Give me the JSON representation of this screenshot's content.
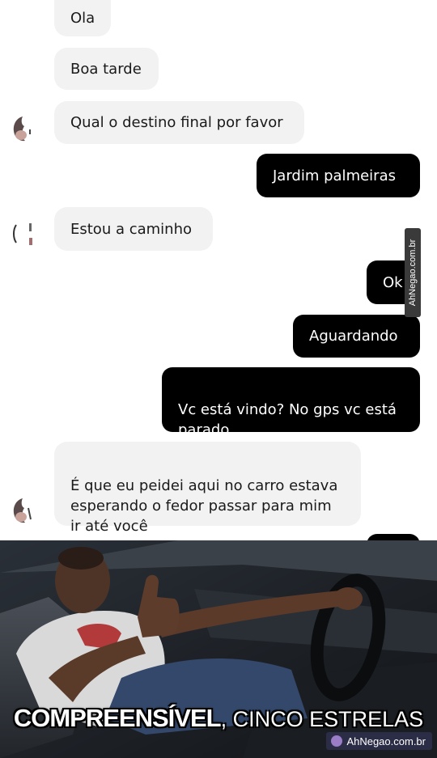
{
  "conversation": {
    "messages": [
      {
        "side": "received",
        "text": "Ola"
      },
      {
        "side": "received",
        "text": "Boa tarde"
      },
      {
        "side": "received",
        "text": "Qual o destino final por favor"
      },
      {
        "side": "sent",
        "text": "Jardim palmeiras"
      },
      {
        "side": "received",
        "text": "Estou a caminho"
      },
      {
        "side": "sent",
        "text": "Ok"
      },
      {
        "side": "sent",
        "text": "Aguardando"
      },
      {
        "side": "sent",
        "text": "Vc está vindo? No gps vc está\nparado"
      },
      {
        "side": "received",
        "text": "É que eu peidei aqui no carro estava\nesperando o fedor passar para mim\nir até você"
      }
    ]
  },
  "watermark": {
    "side_text": "AhNegao.com.br"
  },
  "meme": {
    "caption_bold": "COMPREENSÍVEL",
    "caption_comma": ",",
    "caption_regular": " CINCO ESTRELAS",
    "brand": "AhNegao.com.br"
  },
  "colors": {
    "received_bubble": "#f2f2f2",
    "sent_bubble": "#000000",
    "caption": "#ffffff"
  }
}
